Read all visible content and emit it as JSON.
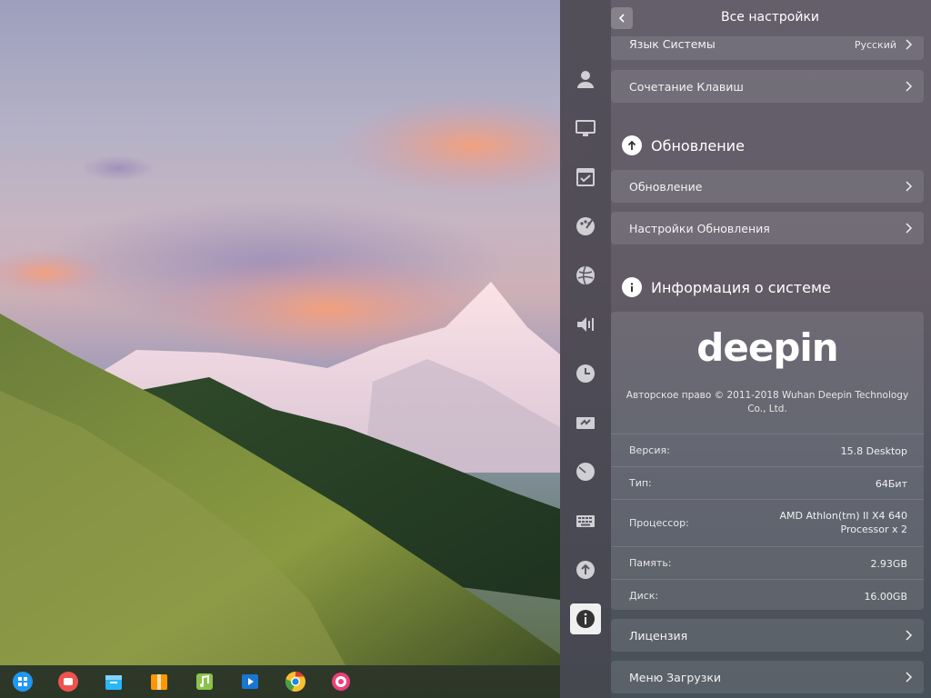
{
  "header": {
    "title": "Все настройки"
  },
  "language_row": {
    "label": "Язык Системы",
    "value": "Русский"
  },
  "keyboard_shortcuts_row": {
    "label": "Сочетание Клавиш"
  },
  "update_section": {
    "title": "Обновление",
    "rows": [
      {
        "label": "Обновление"
      },
      {
        "label": "Настройки Обновления"
      }
    ]
  },
  "system_info": {
    "title": "Информация о системе",
    "logo_text": "deepin",
    "copyright": "Авторское право © 2011-2018 Wuhan Deepin Technology Co., Ltd.",
    "rows": [
      {
        "key": "Версия:",
        "value": "15.8 Desktop"
      },
      {
        "key": "Тип:",
        "value": "64Бит"
      },
      {
        "key": "Процессор:",
        "value": "AMD Athlon(tm) II X4 640 Processor x 2"
      },
      {
        "key": "Память:",
        "value": "2.93GB"
      },
      {
        "key": "Диск:",
        "value": "16.00GB"
      }
    ]
  },
  "license_row": {
    "label": "Лицензия"
  },
  "boot_menu_row": {
    "label": "Меню Загрузки"
  },
  "sidebar": {
    "items": [
      "accounts-icon",
      "display-icon",
      "default-apps-icon",
      "personalization-icon",
      "network-icon",
      "sound-icon",
      "time-icon",
      "power-icon",
      "mouse-icon",
      "keyboard-icon",
      "update-icon",
      "system-info-icon"
    ],
    "active": "system-info-icon"
  },
  "dock": {
    "items": [
      "launcher-icon",
      "screen-recorder-icon",
      "app-store-icon",
      "archive-manager-icon",
      "music-icon",
      "movie-icon",
      "chrome-icon",
      "control-center-icon"
    ]
  },
  "colors": {
    "panel": "#5a5560",
    "accent_active": "#ffffff",
    "wallpaper_sky": "#b4b1c6"
  }
}
